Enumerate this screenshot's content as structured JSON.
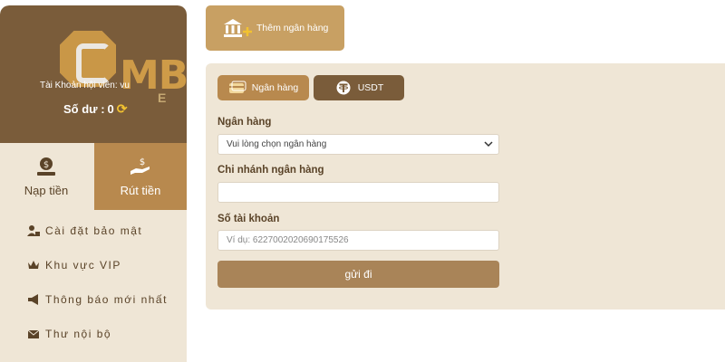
{
  "sidebar": {
    "logo_text": "MB",
    "logo_sub": "E",
    "account_label": "Tài Khoản hội viên: vu",
    "balance_label": "Số dư :",
    "balance_value": "0",
    "deposit_label": "Nạp tiền",
    "withdraw_label": "Rút tiền",
    "menu": [
      {
        "label": "Cài đặt bảo mật",
        "icon": "user-lock-icon"
      },
      {
        "label": "Khu vực VIP",
        "icon": "crown-icon"
      },
      {
        "label": "Thông báo mới nhất",
        "icon": "megaphone-icon"
      },
      {
        "label": "Thư nội bộ",
        "icon": "envelope-icon"
      }
    ]
  },
  "add_bank": {
    "label": "Thêm ngân hàng",
    "icon": "bank-plus-icon"
  },
  "tabs": [
    {
      "label": "Ngân hàng",
      "icon": "card-icon"
    },
    {
      "label": "USDT",
      "icon": "tether-icon"
    }
  ],
  "form": {
    "bank_label": "Ngân hàng",
    "bank_select_value": "Vui lòng chọn ngân hàng",
    "branch_label": "Chi nhánh ngân hàng",
    "branch_value": "",
    "account_label": "Số tài khoản",
    "account_placeholder": "Ví dụ:  6227002020690175526",
    "submit_label": "gửi đi"
  },
  "colors": {
    "brown_dark": "#7a5c3a",
    "brown_light": "#b8894e",
    "cream": "#efe6d6",
    "gold": "#c8a063"
  }
}
